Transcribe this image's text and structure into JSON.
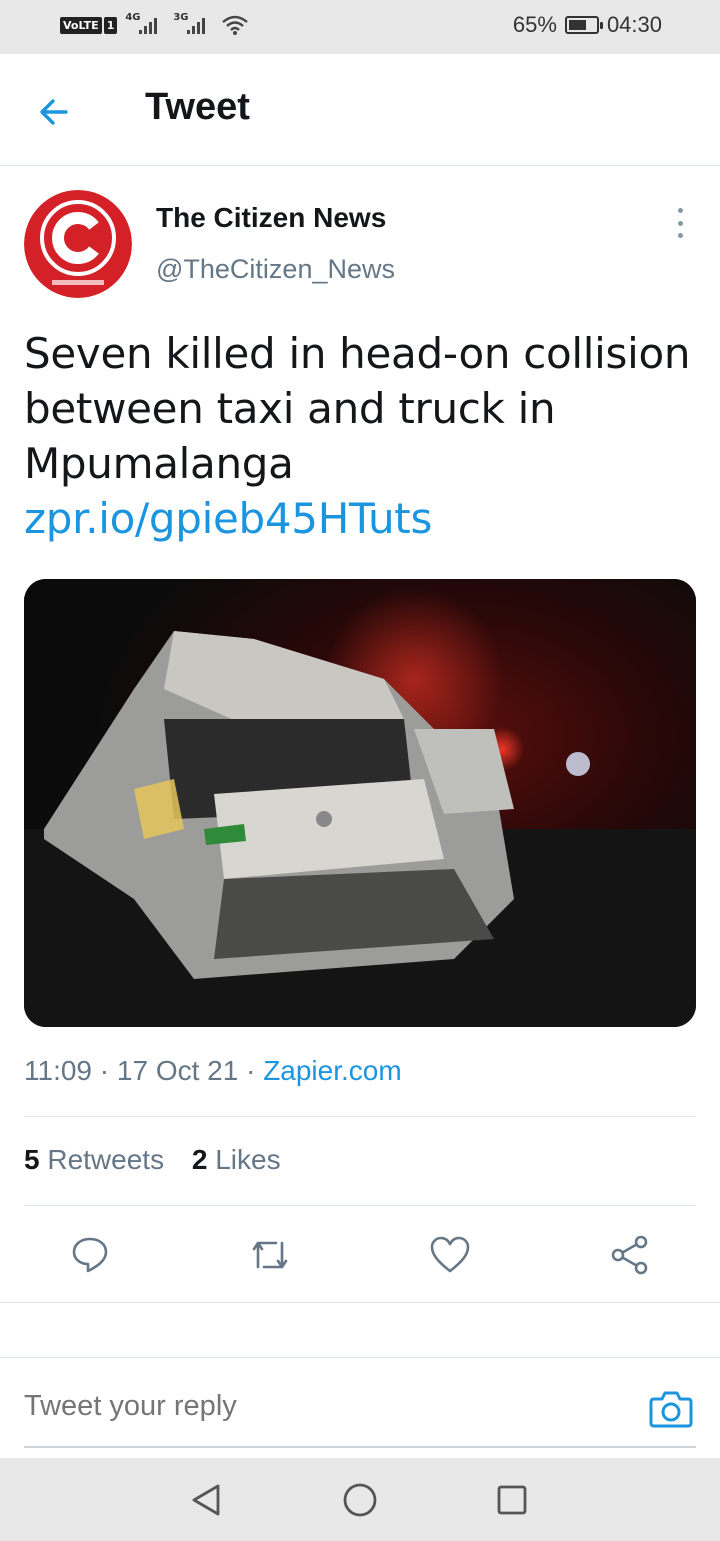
{
  "status_bar": {
    "volte_label": "VoLTE",
    "sim_label": "1",
    "network_1": "4G",
    "network_2": "3G",
    "battery_percent": "65%",
    "battery_level": 0.65,
    "time": "04:30"
  },
  "header": {
    "title": "Tweet",
    "back_icon": "arrow-left-icon"
  },
  "author": {
    "name": "The Citizen News",
    "handle": "@TheCitizen_News",
    "avatar_letter": "C",
    "avatar_tagline": "MORE NEWS YOUR WAY",
    "avatar_color": "#d42027"
  },
  "tweet": {
    "text": "Seven killed in head-on collision between taxi and truck in Mpumalanga",
    "link": "zpr.io/gpieb45HTuts"
  },
  "meta": {
    "time": "11:09",
    "date": "17 Oct 21",
    "source": "Zapier.com",
    "separator": "·"
  },
  "stats": {
    "retweets_count": "5",
    "retweets_label": "Retweets",
    "likes_count": "2",
    "likes_label": "Likes"
  },
  "actions": [
    "reply-icon",
    "retweet-icon",
    "like-icon",
    "share-icon"
  ],
  "reply": {
    "placeholder": "Tweet your reply"
  },
  "colors": {
    "accent": "#1b95e0",
    "text": "#14171a",
    "secondary": "#657786",
    "icon": "#657786"
  }
}
